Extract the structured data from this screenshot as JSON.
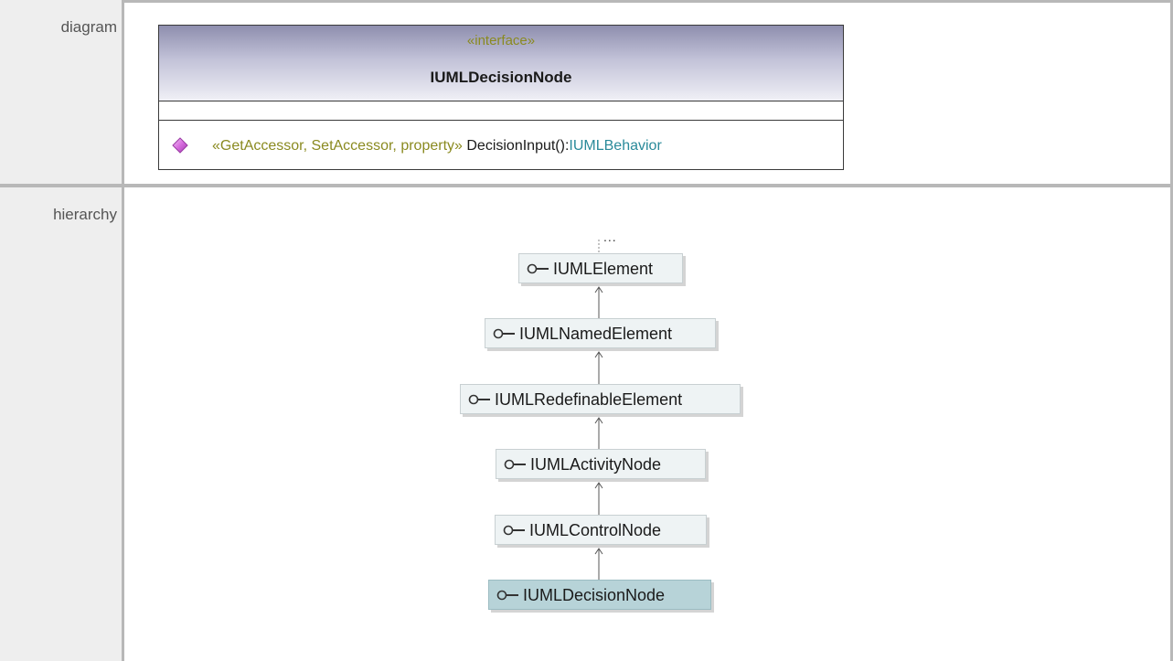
{
  "rows": {
    "diagram_label": "diagram",
    "hierarchy_label": "hierarchy"
  },
  "interface_box": {
    "stereotype": "«interface»",
    "name": "IUMLDecisionNode",
    "operation": {
      "icon": "diamond-operation-icon",
      "stereotype": "«GetAccessor, SetAccessor, property»",
      "name": "DecisionInput():",
      "return_type": "IUMLBehavior"
    }
  },
  "hierarchy": {
    "more_indicator": "...",
    "nodes": [
      {
        "name": "IUMLElement",
        "icon": "interface-lollipop-icon",
        "current": false
      },
      {
        "name": "IUMLNamedElement",
        "icon": "interface-lollipop-icon",
        "current": false
      },
      {
        "name": "IUMLRedefinableElement",
        "icon": "interface-lollipop-icon",
        "current": false
      },
      {
        "name": "IUMLActivityNode",
        "icon": "interface-lollipop-icon",
        "current": false
      },
      {
        "name": "IUMLControlNode",
        "icon": "interface-lollipop-icon",
        "current": false
      },
      {
        "name": "IUMLDecisionNode",
        "icon": "interface-lollipop-icon",
        "current": true
      }
    ]
  },
  "colors": {
    "stereotype": "#8a8a20",
    "return_type": "#2a8a9a",
    "current_node": "#b7d3d8",
    "node": "#eef3f4",
    "operation_icon": "#d070d8"
  }
}
